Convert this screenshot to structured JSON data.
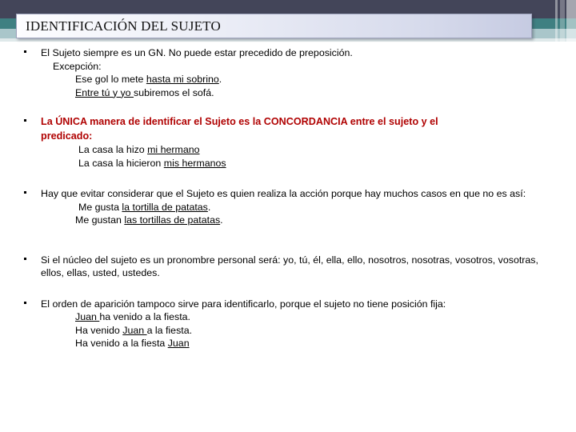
{
  "slide": {
    "title": "IDENTIFICACIÓN DEL SUJETO",
    "accent_dark": "#434559",
    "accent_teal": "#3f8082",
    "accent_light_teal": "#a9c6ca",
    "highlight_color": "#b00202"
  },
  "bullets": [
    {
      "id": "bullet-1",
      "level1": "El Sujeto siempre es un GN. No puede estar precedido de preposición.",
      "level2": "Excepción:",
      "examples": [
        {
          "pre": "Ese gol lo mete ",
          "underlined": "hasta mi sobrino",
          "post": "."
        },
        {
          "pre": "",
          "underlined": "Entre tú y yo ",
          "post": "subiremos el sofá."
        }
      ]
    },
    {
      "id": "bullet-2",
      "level1": "La ÚNICA manera de identificar el Sujeto es la CONCORDANCIA entre el sujeto y el",
      "level1_last": "predicado:",
      "examples": [
        {
          "pre": "La casa la hizo ",
          "underlined": "mi hermano",
          "post": ""
        },
        {
          "pre": "La casa la hicieron ",
          "underlined": "mis hermanos",
          "post": ""
        }
      ]
    },
    {
      "id": "bullet-3",
      "level1": "Hay que evitar considerar que el Sujeto es quien realiza la acción porque hay muchos casos en que no es así:",
      "examples": [
        {
          "pre": "Me gusta ",
          "underlined": "la tortilla de patatas",
          "post": "."
        },
        {
          "pre": "Me gustan ",
          "underlined": "las tortillas de patatas",
          "post": "."
        }
      ]
    },
    {
      "id": "bullet-4",
      "level1": "Si el núcleo del sujeto es un pronombre personal será: yo, tú, él, ella, ello, nosotros, nosotras, vosotros, vosotras, ellos, ellas, usted, ustedes.",
      "examples": []
    },
    {
      "id": "bullet-5",
      "level1": "El orden de aparición tampoco sirve para identificarlo, porque el sujeto  no tiene posición fija:",
      "examples": [
        {
          "pre": "",
          "underlined": "Juan ",
          "post": "ha venido a la fiesta."
        },
        {
          "pre": "Ha venido ",
          "underlined": "Juan ",
          "post": "a la fiesta."
        },
        {
          "pre": "Ha venido a la fiesta ",
          "underlined": "Juan",
          "post": ""
        }
      ]
    }
  ]
}
